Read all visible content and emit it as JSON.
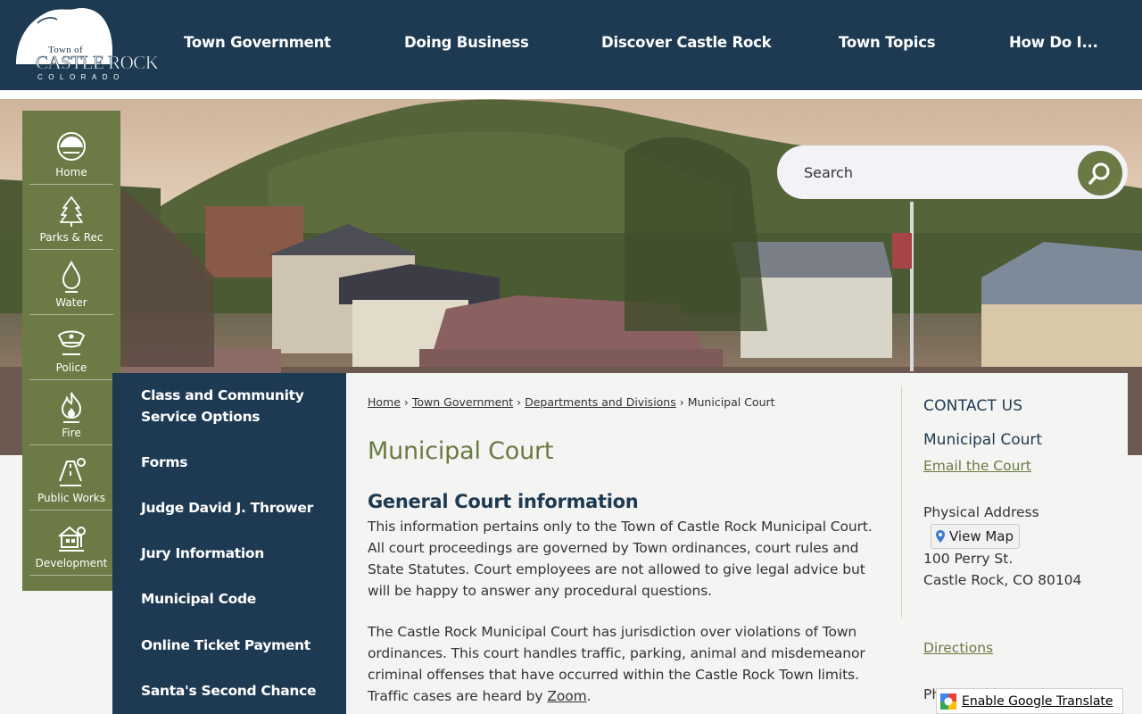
{
  "logo": {
    "town_of": "Town of",
    "name": "Castle Rock",
    "state": "COLORADO"
  },
  "nav": [
    {
      "label": "Town Government"
    },
    {
      "label": "Doing Business"
    },
    {
      "label": "Discover Castle Rock"
    },
    {
      "label": "Town Topics"
    },
    {
      "label": "How Do I..."
    }
  ],
  "search": {
    "placeholder": "Search"
  },
  "quick_links": [
    {
      "label": "Home",
      "icon": "castle-rock-icon"
    },
    {
      "label": "Parks & Rec",
      "icon": "tree-icon"
    },
    {
      "label": "Water",
      "icon": "water-drop-icon"
    },
    {
      "label": "Police",
      "icon": "police-hat-icon"
    },
    {
      "label": "Fire",
      "icon": "flame-icon"
    },
    {
      "label": "Public Works",
      "icon": "road-icon"
    },
    {
      "label": "Development",
      "icon": "house-icon"
    }
  ],
  "side_nav": [
    {
      "label": "Class and Community Service Options"
    },
    {
      "label": "Forms"
    },
    {
      "label": "Judge David J. Thrower"
    },
    {
      "label": "Jury Information"
    },
    {
      "label": "Municipal Code"
    },
    {
      "label": "Online Ticket Payment"
    },
    {
      "label": "Santa's Second Chance"
    }
  ],
  "breadcrumb": {
    "items": [
      {
        "label": "Home"
      },
      {
        "label": "Town Government"
      },
      {
        "label": "Departments and Divisions"
      }
    ],
    "current": "Municipal Court",
    "separator": "›"
  },
  "main": {
    "title": "Municipal Court",
    "section_title": "General Court information",
    "para1": "This information pertains only to the Town of Castle Rock Municipal Court. All court proceedings are governed by Town ordinances, court rules and State Statutes. Court employees are not allowed to give legal advice but will be happy to answer any procedural questions.",
    "para2_text": "The Castle Rock Municipal Court has jurisdiction over violations of Town ordinances. This court handles traffic, parking, animal and misdemeanor criminal offenses that have occurred within the Castle Rock Town limits. Traffic cases are heard by ",
    "para2_link": "Zoom",
    "para2_end": "."
  },
  "contact": {
    "heading": "CONTACT US",
    "name": "Municipal Court",
    "email_link": "Email the Court",
    "address_label": "Physical Address",
    "map_button": "View Map",
    "street": "100 Perry St.",
    "city": "Castle Rock, CO 80104",
    "directions_link": "Directions",
    "phone_partial": "Ph"
  },
  "translate": {
    "label": "Enable Google Translate"
  },
  "colors": {
    "navy": "#1d3a52",
    "olive": "#6b7a44",
    "background": "#f4f4f2"
  }
}
